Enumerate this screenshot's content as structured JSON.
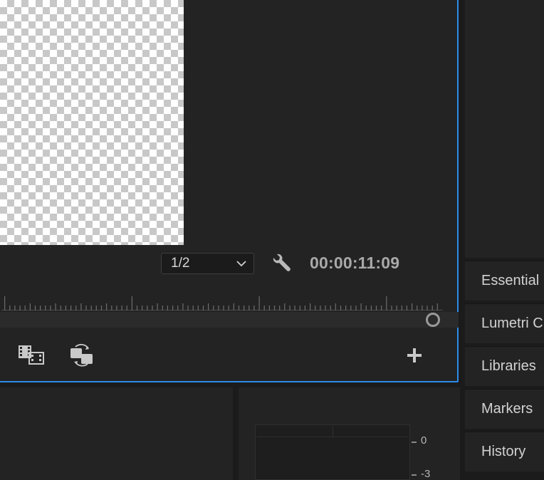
{
  "program_monitor": {
    "resolution_value": "1/2",
    "timecode": "00:00:11:09"
  },
  "icons": {
    "resolution_dropdown": "chevron-down-icon",
    "settings": "wrench-icon",
    "insert": "insert-clip-icon",
    "overwrite": "overwrite-clip-icon",
    "add": "plus-icon",
    "zoom_handle": "circle-handle-icon"
  },
  "panels": {
    "tabs": [
      {
        "label": "Essential"
      },
      {
        "label": "Lumetri C"
      },
      {
        "label": "Libraries"
      },
      {
        "label": "Markers"
      },
      {
        "label": "History"
      }
    ]
  },
  "audio_meter": {
    "labels": [
      "0",
      "-3"
    ]
  },
  "colors": {
    "focus_border": "#2d8ceb",
    "panel_bg": "#232323",
    "app_bg": "#1b1b1b"
  }
}
